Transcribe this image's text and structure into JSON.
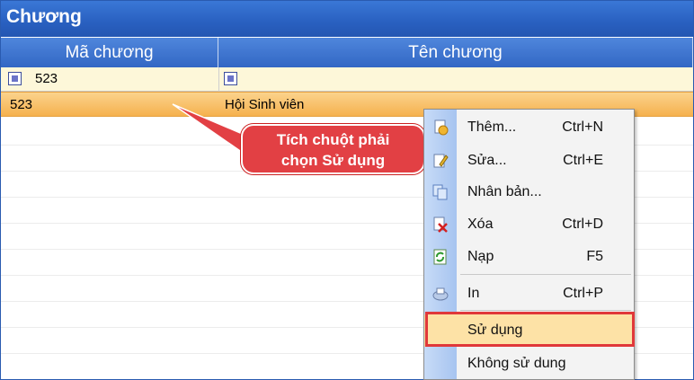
{
  "window": {
    "title": "Chương"
  },
  "columns": {
    "code_header": "Mã chương",
    "name_header": "Tên chương"
  },
  "filter": {
    "code_value": "523",
    "name_value": ""
  },
  "rows": [
    {
      "code": "523",
      "name": "Hội Sinh viên"
    }
  ],
  "callout": {
    "line1": "Tích chuột phải",
    "line2": "chọn Sử dụng"
  },
  "context_menu": {
    "items": [
      {
        "label": "Thêm...",
        "shortcut": "Ctrl+N",
        "icon": "add-record-icon"
      },
      {
        "label": "Sửa...",
        "shortcut": "Ctrl+E",
        "icon": "edit-icon"
      },
      {
        "label": "Nhân bản...",
        "shortcut": "",
        "icon": "duplicate-icon"
      },
      {
        "label": "Xóa",
        "shortcut": "Ctrl+D",
        "icon": "delete-icon"
      },
      {
        "label": "Nạp",
        "shortcut": "F5",
        "icon": "refresh-icon"
      },
      {
        "label": "In",
        "shortcut": "Ctrl+P",
        "icon": "print-icon"
      },
      {
        "label": "Sử dụng",
        "shortcut": "",
        "icon": ""
      },
      {
        "label": "Không sử dung",
        "shortcut": "",
        "icon": ""
      }
    ]
  },
  "colors": {
    "title_bar": "#2960c0",
    "selected_row": "#f5b14e",
    "callout": "#e24044",
    "highlight_border": "#e0383a"
  }
}
